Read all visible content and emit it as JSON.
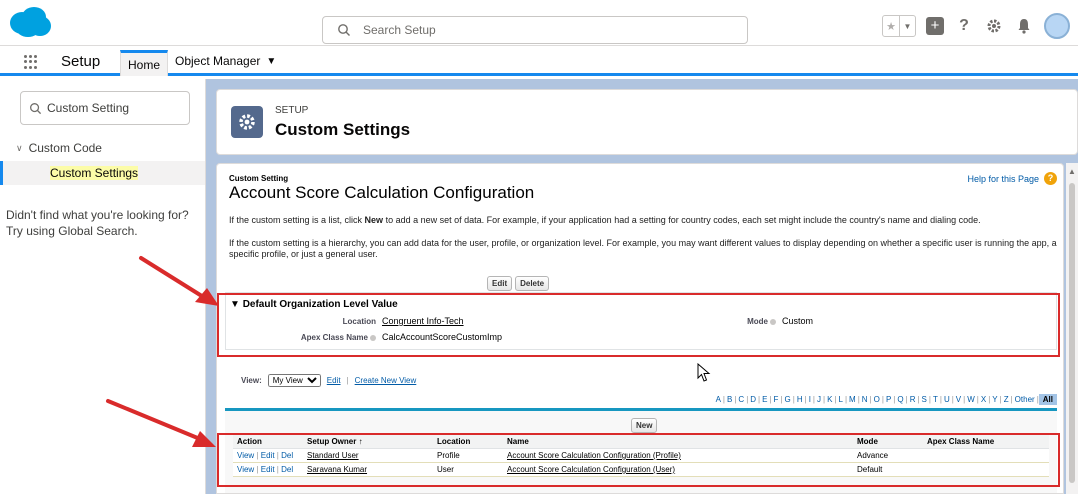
{
  "header": {
    "search_placeholder": "Search Setup"
  },
  "nav": {
    "app_name": "Setup",
    "tabs": [
      {
        "label": "Home"
      },
      {
        "label": "Object Manager"
      }
    ]
  },
  "sidebar": {
    "quick_find_value": "Custom Setting",
    "group_label": "Custom Code",
    "item_label": "Custom Settings",
    "no_result_text": "Didn't find what you're looking for? Try using Global Search."
  },
  "page_header": {
    "breadcrumb": "SETUP",
    "title": "Custom Settings"
  },
  "detail": {
    "type_label": "Custom Setting",
    "title": "Account Score Calculation Configuration",
    "help_link": "Help for this Page",
    "desc1_prefix": "If the custom setting is a list, click ",
    "desc1_bold": "New",
    "desc1_suffix": " to add a new set of data. For example, if your application had a setting for country codes, each set might include the country's name and dialing code.",
    "desc2": "If the custom setting is a hierarchy, you can add data for the user, profile, or organization level. For example, you may want different values to display depending on whether a specific user is running the app, a specific profile, or just a general user.",
    "edit_button": "Edit",
    "delete_button": "Delete"
  },
  "org_section": {
    "heading": "Default Organization Level Value",
    "location_label": "Location",
    "location_value": "Congruent Info-Tech",
    "mode_label": "Mode",
    "mode_value": "Custom",
    "apex_label": "Apex Class Name",
    "apex_value": "CalcAccountScoreCustomImp"
  },
  "list_view": {
    "view_label": "View:",
    "view_selected": "My View",
    "edit_link": "Edit",
    "create_link": "Create New View",
    "alphabet": [
      "A",
      "B",
      "C",
      "D",
      "E",
      "F",
      "G",
      "H",
      "I",
      "J",
      "K",
      "L",
      "M",
      "N",
      "O",
      "P",
      "Q",
      "R",
      "S",
      "T",
      "U",
      "V",
      "W",
      "X",
      "Y",
      "Z",
      "Other"
    ],
    "all_label": "All",
    "new_button": "New"
  },
  "table": {
    "columns": [
      "Action",
      "Setup Owner ↑",
      "Location",
      "Name",
      "Mode",
      "Apex Class Name"
    ],
    "action_view": "View",
    "action_edit": "Edit",
    "action_del": "Del",
    "rows": [
      {
        "owner": "Standard User",
        "location": "Profile",
        "name": "Account Score Calculation Configuration (Profile)",
        "mode": "Advance",
        "apex": ""
      },
      {
        "owner": "Saravana Kumar",
        "location": "User",
        "name": "Account Score Calculation Configuration (User)",
        "mode": "Default",
        "apex": ""
      }
    ]
  },
  "colors": {
    "brand_blue": "#1589ee",
    "annotation_red": "#d92b2b",
    "main_background": "#b0c4df"
  },
  "icons": {
    "logo": "salesforce-cloud-logo",
    "search": "search-icon",
    "settings": "gear-icon"
  }
}
